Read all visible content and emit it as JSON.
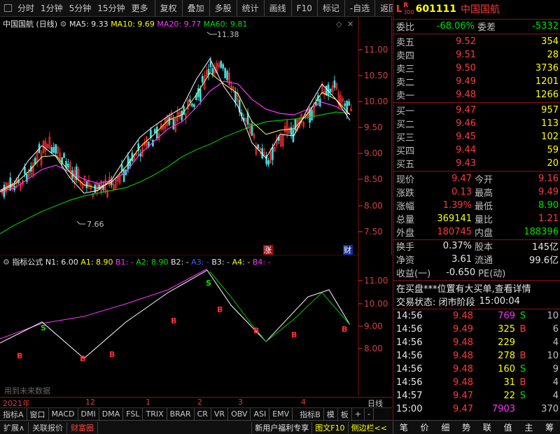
{
  "toolbar": {
    "timeframes": [
      "分时",
      "1分钟",
      "5分钟",
      "15分钟",
      "更多"
    ],
    "buttons": [
      "复权",
      "叠加",
      "多股",
      "统计",
      "画线",
      "F10",
      "标记",
      "-自选",
      "返回"
    ]
  },
  "main_chart": {
    "title": "中国国航 (日线)",
    "ma5": "MA5: 9.33",
    "ma10": "MA10: 9.69",
    "ma20": "MA20: 9.77",
    "ma60": "MA60: 9.81",
    "high_marker": "11.38",
    "low_marker": "7.66",
    "price_ticks": [
      "11.00",
      "10.50",
      "10.00",
      "9.50",
      "9.00",
      "8.50",
      "8.00",
      "7.50"
    ],
    "badge_zhang": "涨",
    "badge_cai": "财"
  },
  "indicator": {
    "title": "指标公式",
    "params": [
      "N1: 6.00",
      "A1: 8.90",
      "B1: -",
      "A2: 8.90",
      "B2: -",
      "A3: -",
      "B3: -",
      "A4: -",
      "B4: -"
    ],
    "ticks": [
      "11.00",
      "10.00",
      "9.00",
      "8.00"
    ],
    "watermark": "用到未来数据"
  },
  "time_axis": {
    "labels": [
      "2021年",
      "12",
      "1",
      "2",
      "3",
      "4"
    ],
    "right_label": "日线"
  },
  "tabs": [
    "指标A",
    "窗口",
    "MACD",
    "DMI",
    "DMA",
    "FSL",
    "TRIX",
    "BRAR",
    "CR",
    "VR",
    "OBV",
    "ASI",
    "EMV",
    "指标B",
    "模",
    "板",
    "+",
    "-"
  ],
  "footer_left": [
    "扩展∧",
    "关联报价",
    "财富圈"
  ],
  "footer_mid": [
    "新用户福利专享",
    "图文F10",
    "侧边栏<<"
  ],
  "footer_right": [
    "笔",
    "价",
    "细",
    "势",
    "联",
    "值",
    "主",
    "筹"
  ],
  "quote": {
    "tag_l": "L",
    "tag_r": "R",
    "tag_300": "300",
    "code": "601111",
    "name": "中国国航",
    "webi_label": "委比",
    "webi_value": "-68.06%",
    "weicha_label": "委差",
    "weicha_value": "-5332",
    "asks": [
      {
        "label": "卖五",
        "price": "9.52",
        "vol": "354"
      },
      {
        "label": "卖四",
        "price": "9.51",
        "vol": "28"
      },
      {
        "label": "卖三",
        "price": "9.50",
        "vol": "3736"
      },
      {
        "label": "卖二",
        "price": "9.49",
        "vol": "1201"
      },
      {
        "label": "卖一",
        "price": "9.48",
        "vol": "1266"
      }
    ],
    "bids": [
      {
        "label": "买一",
        "price": "9.47",
        "vol": "957"
      },
      {
        "label": "买二",
        "price": "9.46",
        "vol": "113"
      },
      {
        "label": "买三",
        "price": "9.45",
        "vol": "102"
      },
      {
        "label": "买四",
        "price": "9.44",
        "vol": "59"
      },
      {
        "label": "买五",
        "price": "9.43",
        "vol": "20"
      }
    ],
    "stats": [
      {
        "l1": "现价",
        "v1": "9.47",
        "l2": "今开",
        "v2": "9.16"
      },
      {
        "l1": "涨跌",
        "v1": "0.13",
        "l2": "最高",
        "v2": "9.49"
      },
      {
        "l1": "涨幅",
        "v1": "1.39%",
        "l2": "最低",
        "v2": "8.90"
      },
      {
        "l1": "总量",
        "v1": "369141",
        "l2": "量比",
        "v2": "1.21"
      },
      {
        "l1": "外盘",
        "v1": "180745",
        "l2": "内盘",
        "v2": "188396"
      }
    ],
    "stats2": [
      {
        "l1": "换手",
        "v1": "0.37%",
        "l2": "股本",
        "v2": "145亿"
      },
      {
        "l1": "净资",
        "v1": "3.61",
        "l2": "流通",
        "v2": "99.6亿"
      }
    ],
    "shouyi_label": "收益(一)",
    "shouyi_value": "-0.650",
    "pe_label": "PE(动)",
    "pe_value": "",
    "notice": "在买盘***位置有大买单,查看详情",
    "status": "交易状态: 闭市阶段",
    "status_time": "15:00:04",
    "trades": [
      {
        "time": "14:56",
        "price": "9.48",
        "vol": "769",
        "side": "S",
        "n": "10"
      },
      {
        "time": "14:56",
        "price": "9.49",
        "vol": "325",
        "side": "B",
        "n": "6"
      },
      {
        "time": "14:56",
        "price": "9.48",
        "vol": "229",
        "side": "",
        "n": "4"
      },
      {
        "time": "14:56",
        "price": "9.48",
        "vol": "278",
        "side": "B",
        "n": "10"
      },
      {
        "time": "14:56",
        "price": "9.48",
        "vol": "160",
        "side": "S",
        "n": "9"
      },
      {
        "time": "14:56",
        "price": "9.48",
        "vol": "31",
        "side": "B",
        "n": "4"
      },
      {
        "time": "14:57",
        "price": "9.47",
        "vol": "22",
        "side": "S",
        "n": "4"
      },
      {
        "time": "15:00",
        "price": "9.47",
        "vol": "7903",
        "side": "",
        "n": "370"
      }
    ]
  }
}
